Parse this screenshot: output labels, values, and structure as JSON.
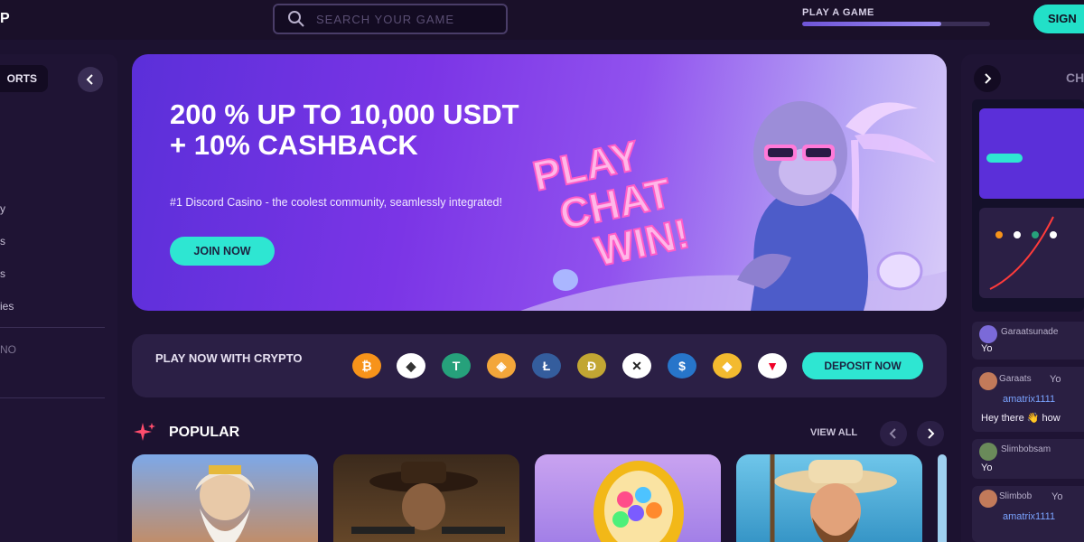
{
  "header": {
    "logo_text": "P",
    "search_placeholder": "SEARCH YOUR GAME",
    "play_game_label": "PLAY A GAME",
    "play_game_progress": 0.74,
    "sign_button": "SIGN"
  },
  "sidebar": {
    "sports_label": "ORTS",
    "items": [
      "y",
      "s",
      "s",
      "ies"
    ],
    "section_label": "NO"
  },
  "hero": {
    "title": "200 % UP TO 10,000 USDT + 10% CASHBACK",
    "subtitle": "#1 Discord Casino - the coolest community, seamlessly integrated!",
    "join_button": "JOIN NOW",
    "art_lines": [
      "PLAY",
      "CHAT",
      "WIN!"
    ]
  },
  "crypto": {
    "label": "PLAY NOW WITH CRYPTO",
    "coins": [
      "bitcoin",
      "ethereum",
      "tether",
      "bnb",
      "litecoin",
      "dogecoin",
      "xrp",
      "usdc",
      "binance",
      "tron"
    ],
    "deposit_button": "DEPOSIT NOW"
  },
  "popular": {
    "title": "POPULAR",
    "view_all": "VIEW ALL"
  },
  "chat": {
    "title": "CH",
    "messages": [
      {
        "user": "Garaatsunade",
        "text": "Yo"
      },
      {
        "user": "Garaats",
        "text": "Yo",
        "link": "amatrix1111",
        "extra": "Hey there 👋 how"
      },
      {
        "user": "Slimbobsam",
        "text": "Yo"
      },
      {
        "user": "Slimbob",
        "text": "Yo",
        "link": "amatrix1111"
      }
    ]
  },
  "colors": {
    "background": "#1c1230",
    "accent": "#2ee6d2",
    "panel": "#2b1f45"
  }
}
